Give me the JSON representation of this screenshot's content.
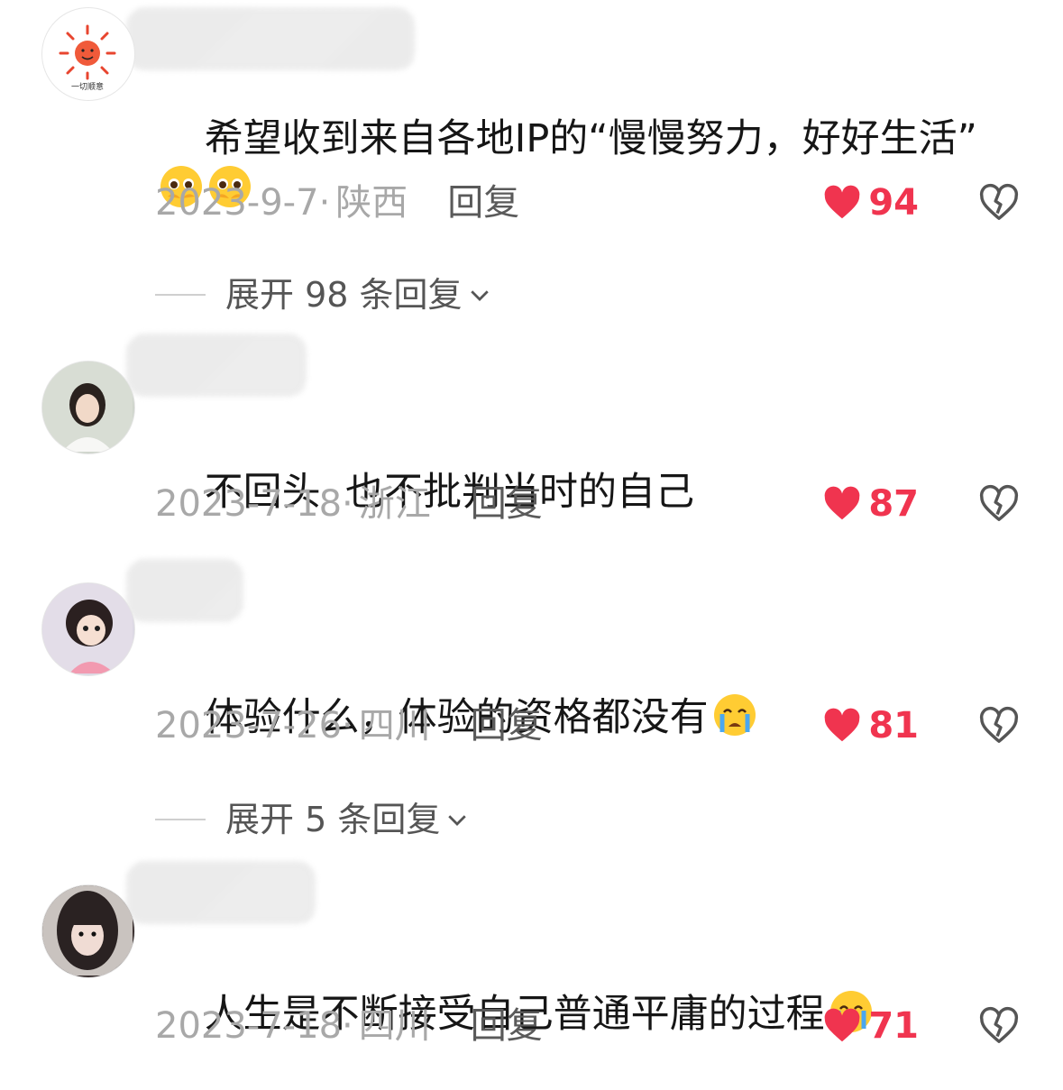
{
  "comments": [
    {
      "avatar_label": "一切顺意",
      "text": "希望收到来自各地IP的“慢慢努力，好好生活”",
      "emojis": [
        "pleading-face-icon",
        "pleading-face-icon"
      ],
      "date": "2023-9-7·",
      "location": "陕西",
      "reply_label": "回复",
      "likes": "94",
      "expand_label": "展开 98 条回复"
    },
    {
      "text": "不回头  也不批判当时的自己",
      "emojis": [],
      "date": "2023-7-18·",
      "location": "浙江",
      "reply_label": "回复",
      "likes": "87"
    },
    {
      "text": "体验什么，体验的资格都没有",
      "emojis": [
        "crying-face-icon"
      ],
      "date": "2023-7-26·",
      "location": "四川",
      "reply_label": "回复",
      "likes": "81",
      "expand_label": "展开 5 条回复"
    },
    {
      "text": "人生是不断接受自己普通平庸的过程",
      "emojis": [
        "crying-face-icon"
      ],
      "date": "2023-7-18·",
      "location": "四川",
      "reply_label": "回复",
      "likes": "71"
    }
  ],
  "colors": {
    "like_red": "#f0344f",
    "meta_gray": "#a8a8a8",
    "text_dark": "#161616"
  }
}
